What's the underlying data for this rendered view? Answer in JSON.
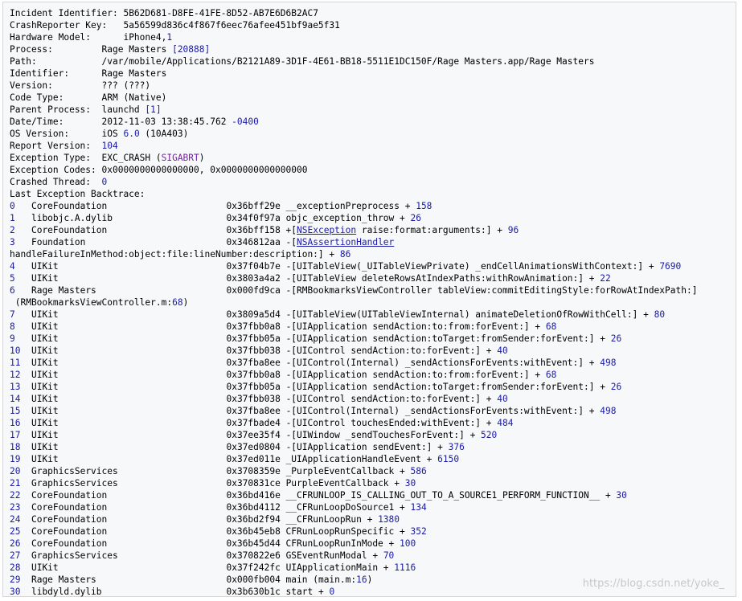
{
  "header": [
    {
      "label": "Incident Identifier: ",
      "value": "5B62D681-D8FE-41FE-8D52-AB7E6D6B2AC7"
    },
    {
      "label": "CrashReporter Key:   ",
      "value": "5a56599d836c4f867f6eec76afee451bf9ae5f31"
    },
    {
      "label": "Hardware Model:      ",
      "value": "iPhone4,",
      "value2": "1"
    },
    {
      "label": "Process:         ",
      "value": "Rage Masters ",
      "value2": "[20888]"
    },
    {
      "label": "Path:            ",
      "value": "/var/mobile/Applications/B2121A89-3D1F-4E61-BB18-5511E1DC150F/Rage Masters.app/Rage Masters"
    },
    {
      "label": "Identifier:      ",
      "value": "Rage Masters"
    },
    {
      "label": "Version:         ",
      "value": "??? (???)"
    },
    {
      "label": "Code Type:       ",
      "value": "ARM (Native)"
    },
    {
      "label": "Parent Process:  ",
      "value": "launchd ",
      "value2": "[1]"
    },
    {
      "label": "Date/Time:       ",
      "value": "2012-11-03 13:38:45.762",
      "value2": " -0400"
    },
    {
      "label": "OS Version:      ",
      "value": "iOS ",
      "value2": "6.0",
      "value3": " (10A403)"
    },
    {
      "label": "Report Version:  ",
      "value": "104"
    },
    {
      "label": "Exception Type:  ",
      "value": "EXC_CRASH (",
      "value2": "SIGABRT",
      "value3": ")"
    },
    {
      "label": "Exception Codes: ",
      "value": "0x0000000000000000, 0x0000000000000000"
    },
    {
      "label": "Crashed Thread:  ",
      "value": "0"
    },
    {
      "label": "Last Exception Backtrace:",
      "value": ""
    }
  ],
  "frames": [
    {
      "n": "0",
      "lib": "CoreFoundation",
      "addr": "0x36bff29e",
      "sym": " __exceptionPreprocess + ",
      "off": "158"
    },
    {
      "n": "1",
      "lib": "libobjc.A.dylib",
      "addr": "0x34f0f97a",
      "sym": " objc_exception_throw + ",
      "off": "26"
    },
    {
      "n": "2",
      "lib": "CoreFoundation",
      "addr": "0x36bff158",
      "sym_pre": " +[",
      "link": "NSException",
      "sym": " raise:format:arguments:] + ",
      "off": "96"
    },
    {
      "n": "3",
      "lib": "Foundation",
      "addr": "0x346812aa",
      "sym_pre": " -[",
      "link": "NSAssertionHandler",
      "sym": "",
      "off": ""
    },
    {
      "cont": "handleFailureInMethod:object:file:lineNumber:description:] + ",
      "off": "86"
    },
    {
      "n": "4",
      "lib": "UIKit",
      "addr": "0x37f04b7e",
      "sym": " -[UITableView(_UITableViewPrivate) _endCellAnimationsWithContext:] + ",
      "off": "7690"
    },
    {
      "n": "5",
      "lib": "UIKit",
      "addr": "0x3803a4a2",
      "sym": " -[UITableView deleteRowsAtIndexPaths:withRowAnimation:] + ",
      "off": "22"
    },
    {
      "n": "6",
      "lib": "Rage Masters",
      "addr": "0x000fd9ca",
      "sym": " -[RMBookmarksViewController tableView:commitEditingStyle:forRowAtIndexPath:]",
      "off": ""
    },
    {
      "cont": " (RMBookmarksViewController.m:",
      "off": "68",
      "tail": ")"
    },
    {
      "n": "7",
      "lib": "UIKit",
      "addr": "0x3809a5d4",
      "sym": " -[UITableView(UITableViewInternal) animateDeletionOfRowWithCell:] + ",
      "off": "80"
    },
    {
      "n": "8",
      "lib": "UIKit",
      "addr": "0x37fbb0a8",
      "sym": " -[UIApplication sendAction:to:from:forEvent:] + ",
      "off": "68"
    },
    {
      "n": "9",
      "lib": "UIKit",
      "addr": "0x37fbb05a",
      "sym": " -[UIApplication sendAction:toTarget:fromSender:forEvent:] + ",
      "off": "26"
    },
    {
      "n": "10",
      "lib": "UIKit",
      "addr": "0x37fbb038",
      "sym": " -[UIControl sendAction:to:forEvent:] + ",
      "off": "40"
    },
    {
      "n": "11",
      "lib": "UIKit",
      "addr": "0x37fba8ee",
      "sym": " -[UIControl(Internal) _sendActionsForEvents:withEvent:] + ",
      "off": "498"
    },
    {
      "n": "12",
      "lib": "UIKit",
      "addr": "0x37fbb0a8",
      "sym": " -[UIApplication sendAction:to:from:forEvent:] + ",
      "off": "68"
    },
    {
      "n": "13",
      "lib": "UIKit",
      "addr": "0x37fbb05a",
      "sym": " -[UIApplication sendAction:toTarget:fromSender:forEvent:] + ",
      "off": "26"
    },
    {
      "n": "14",
      "lib": "UIKit",
      "addr": "0x37fbb038",
      "sym": " -[UIControl sendAction:to:forEvent:] + ",
      "off": "40"
    },
    {
      "n": "15",
      "lib": "UIKit",
      "addr": "0x37fba8ee",
      "sym": " -[UIControl(Internal) _sendActionsForEvents:withEvent:] + ",
      "off": "498"
    },
    {
      "n": "16",
      "lib": "UIKit",
      "addr": "0x37fbade4",
      "sym": " -[UIControl touchesEnded:withEvent:] + ",
      "off": "484"
    },
    {
      "n": "17",
      "lib": "UIKit",
      "addr": "0x37ee35f4",
      "sym": " -[UIWindow _sendTouchesForEvent:] + ",
      "off": "520"
    },
    {
      "n": "18",
      "lib": "UIKit",
      "addr": "0x37ed0804",
      "sym": " -[UIApplication sendEvent:] + ",
      "off": "376"
    },
    {
      "n": "19",
      "lib": "UIKit",
      "addr": "0x37ed011e",
      "sym": " _UIApplicationHandleEvent + ",
      "off": "6150"
    },
    {
      "n": "20",
      "lib": "GraphicsServices",
      "addr": "0x3708359e",
      "sym": " _PurpleEventCallback + ",
      "off": "586"
    },
    {
      "n": "21",
      "lib": "GraphicsServices",
      "addr": "0x370831ce",
      "sym": " PurpleEventCallback + ",
      "off": "30"
    },
    {
      "n": "22",
      "lib": "CoreFoundation",
      "addr": "0x36bd416e",
      "sym": " __CFRUNLOOP_IS_CALLING_OUT_TO_A_SOURCE1_PERFORM_FUNCTION__ + ",
      "off": "30"
    },
    {
      "n": "23",
      "lib": "CoreFoundation",
      "addr": "0x36bd4112",
      "sym": " __CFRunLoopDoSource1 + ",
      "off": "134"
    },
    {
      "n": "24",
      "lib": "CoreFoundation",
      "addr": "0x36bd2f94",
      "sym": " __CFRunLoopRun + ",
      "off": "1380"
    },
    {
      "n": "25",
      "lib": "CoreFoundation",
      "addr": "0x36b45eb8",
      "sym": " CFRunLoopRunSpecific + ",
      "off": "352"
    },
    {
      "n": "26",
      "lib": "CoreFoundation",
      "addr": "0x36b45d44",
      "sym": " CFRunLoopRunInMode + ",
      "off": "100"
    },
    {
      "n": "27",
      "lib": "GraphicsServices",
      "addr": "0x370822e6",
      "sym": " GSEventRunModal + ",
      "off": "70"
    },
    {
      "n": "28",
      "lib": "UIKit",
      "addr": "0x37f242fc",
      "sym": " UIApplicationMain + ",
      "off": "1116"
    },
    {
      "n": "29",
      "lib": "Rage Masters",
      "addr": "0x000fb004",
      "sym": " main (main.m:",
      "off": "16",
      "tail": ")"
    },
    {
      "n": "30",
      "lib": "libdyld.dylib",
      "addr": "0x3b630b1c",
      "sym": " start + ",
      "off": "0"
    }
  ],
  "watermark": "https://blog.csdn.net/yoke_"
}
